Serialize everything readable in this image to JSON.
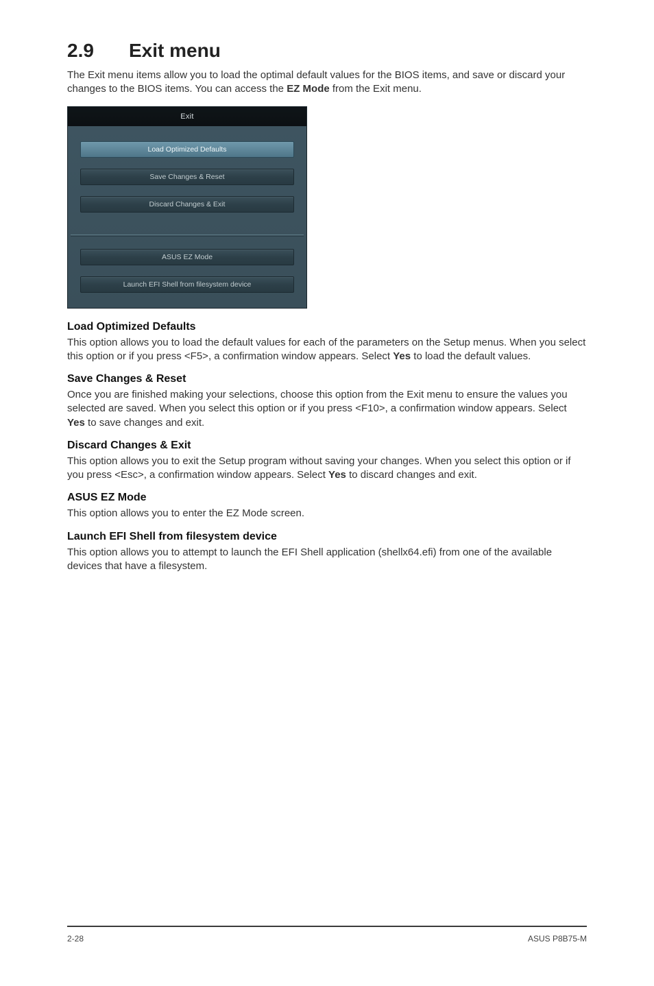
{
  "heading": {
    "number": "2.9",
    "title": "Exit menu"
  },
  "intro": {
    "part1": "The Exit menu items allow you to load the optimal default values for the BIOS items, and save or discard your changes to the BIOS items. You can access the ",
    "ez": "EZ Mode",
    "part2": " from the Exit menu."
  },
  "exit_panel": {
    "title": "Exit",
    "items": [
      {
        "label": "Load Optimized Defaults",
        "selected": true
      },
      {
        "label": "Save Changes & Reset",
        "selected": false
      },
      {
        "label": "Discard Changes & Exit",
        "selected": false
      }
    ],
    "lower": [
      {
        "label": "ASUS EZ Mode"
      },
      {
        "label": "Launch EFI Shell from filesystem device"
      }
    ]
  },
  "sections": {
    "load_defaults": {
      "title": "Load Optimized Defaults",
      "p1a": "This option allows you to load the default values for each of the parameters on the Setup menus. When you select this option or if you press <F5>, a confirmation window appears. Select ",
      "yes": "Yes",
      "p1b": " to load the default values."
    },
    "save_reset": {
      "title": "Save Changes & Reset",
      "p1a": "Once you are finished making your selections, choose this option from the Exit menu to ensure the values you selected are saved. When you select this option or if you press <F10>, a confirmation window appears. Select ",
      "yes": "Yes",
      "p1b": " to save changes and exit."
    },
    "discard_exit": {
      "title": "Discard Changes & Exit",
      "p1a": "This option allows you to exit the Setup program without saving your changes. When you select this option or if you press <Esc>, a confirmation window appears. Select ",
      "yes": "Yes",
      "p1b": " to discard changes and exit."
    },
    "ez_mode": {
      "title": "ASUS EZ Mode",
      "p": "This option allows you to enter the EZ Mode screen."
    },
    "efi_shell": {
      "title": "Launch EFI Shell from filesystem device",
      "p": "This option allows you to attempt to launch the EFI Shell application (shellx64.efi) from one of the available devices that have a filesystem."
    }
  },
  "footer": {
    "page": "2-28",
    "product": "ASUS P8B75-M"
  }
}
